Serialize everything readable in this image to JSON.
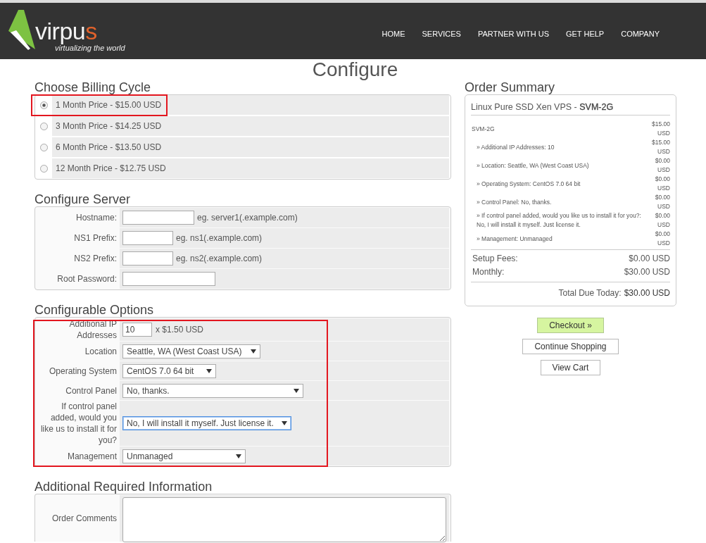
{
  "header": {
    "logo": {
      "wordmark": [
        {
          "text": "virpu",
          "color": "#f2f2f2"
        },
        {
          "text": "s",
          "color": "#e2622b"
        }
      ],
      "tagline": "virtualizing the world"
    },
    "nav": [
      {
        "label": "HOME"
      },
      {
        "label": "SERVICES"
      },
      {
        "label": "PARTNER WITH US"
      },
      {
        "label": "GET HELP"
      },
      {
        "label": "COMPANY"
      }
    ]
  },
  "page_title": "Configure",
  "billing": {
    "title": "Choose Billing Cycle",
    "options": [
      {
        "label": "1 Month Price - $15.00 USD",
        "selected": true,
        "highlighted": true
      },
      {
        "label": "3 Month Price - $14.25 USD",
        "selected": false,
        "highlighted": false
      },
      {
        "label": "6 Month Price - $13.50 USD",
        "selected": false,
        "highlighted": false
      },
      {
        "label": "12 Month Price - $12.75 USD",
        "selected": false,
        "highlighted": false
      }
    ]
  },
  "configure_server": {
    "title": "Configure Server",
    "fields": [
      {
        "label": "Hostname:",
        "hint": "eg. server1(.example.com)"
      },
      {
        "label": "NS1 Prefix:",
        "hint": "eg. ns1(.example.com)"
      },
      {
        "label": "NS2 Prefix:",
        "hint": "eg. ns2(.example.com)"
      },
      {
        "label": "Root Password:"
      }
    ]
  },
  "configurable_options": {
    "title": "Configurable Options",
    "highlighted": true,
    "rows": [
      {
        "kind": "quantity",
        "label": "Additional IP Addresses",
        "value": "10",
        "suffix": "x $1.50 USD",
        "focused": false
      },
      {
        "kind": "dropdown",
        "label": "Location",
        "value": "Seattle, WA (West Coast USA)",
        "focused": false
      },
      {
        "kind": "dropdown",
        "label": "Operating System",
        "value": "CentOS 7.0 64 bit",
        "focused": false
      },
      {
        "kind": "dropdown",
        "label": "Control Panel",
        "value": "No, thanks.",
        "focused": false
      },
      {
        "kind": "dropdown",
        "label": "If control panel added, would you like us to install it for you?",
        "value": "No, I will install it myself. Just license it.",
        "focused": true
      },
      {
        "kind": "dropdown",
        "label": "Management",
        "value": "Unmanaged",
        "focused": false
      }
    ]
  },
  "additional_info": {
    "title": "Additional Required Information",
    "fields": [
      {
        "label": "Order Comments"
      }
    ]
  },
  "order_summary": {
    "title": "Order Summary",
    "product": "Linux Pure SSD Xen VPS - **SVM-2G**",
    "items": [
      {
        "kind": "base",
        "label": "SVM-2G",
        "price": "$15.00 USD"
      },
      {
        "kind": "option",
        "label": "» Additional IP Addresses: 10",
        "price": "$15.00 USD"
      },
      {
        "kind": "option",
        "label": "» Location: Seattle, WA (West Coast USA)",
        "price": "$0.00 USD"
      },
      {
        "kind": "option",
        "label": "» Operating System: CentOS 7.0 64 bit",
        "price": "$0.00 USD"
      },
      {
        "kind": "option",
        "label": "» Control Panel: No, thanks.",
        "price": "$0.00 USD"
      },
      {
        "kind": "option",
        "label": "» If control panel added, would you like us to install it for you?: No, I will install it myself. Just license it.",
        "price": "$0.00 USD"
      },
      {
        "kind": "option",
        "label": "» Management: Unmanaged",
        "price": "$0.00 USD"
      }
    ],
    "totals": [
      {
        "label": "Setup Fees:",
        "value": "$0.00 USD"
      },
      {
        "label": "Monthly:",
        "value": "$30.00 USD"
      }
    ],
    "total_due": {
      "label": "Total Due Today:",
      "value": "$30.00 USD"
    }
  },
  "actions": [
    {
      "label": "Checkout »",
      "kind": "primary"
    },
    {
      "label": "Continue Shopping",
      "kind": "default"
    },
    {
      "label": "View Cart",
      "kind": "default"
    }
  ]
}
